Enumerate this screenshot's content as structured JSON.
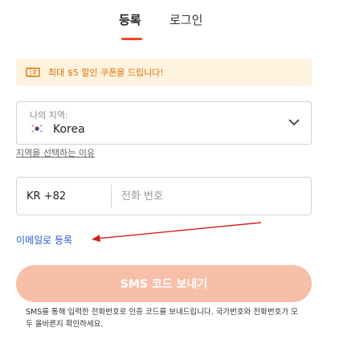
{
  "tabs": {
    "register": "등록",
    "login": "로그인"
  },
  "coupon": {
    "text": "최대 $5 할인 쿠폰을 드립니다!",
    "icon": "coupon-icon",
    "color": "#e07000"
  },
  "region": {
    "label": "나의 지역:",
    "value": "Korea",
    "flag": "kr-flag-icon"
  },
  "why_region_link": "지역을 선택하는 이유",
  "phone": {
    "country_code": "KR +82",
    "placeholder": "전화 번호"
  },
  "email_link": "이메일로 등록",
  "sms_button": "SMS 코드 보내기",
  "notice": "SMS를 통해 입력한 전화번호로 인증 코드를 보내드립니다. 국가번호와 전화번호가 모두 올바른지 확인하세요.",
  "colors": {
    "accent": "#f04b23",
    "button_disabled": "#f7bfa8",
    "link": "#2a5bd7",
    "coupon_bg": "#fff3e0"
  }
}
